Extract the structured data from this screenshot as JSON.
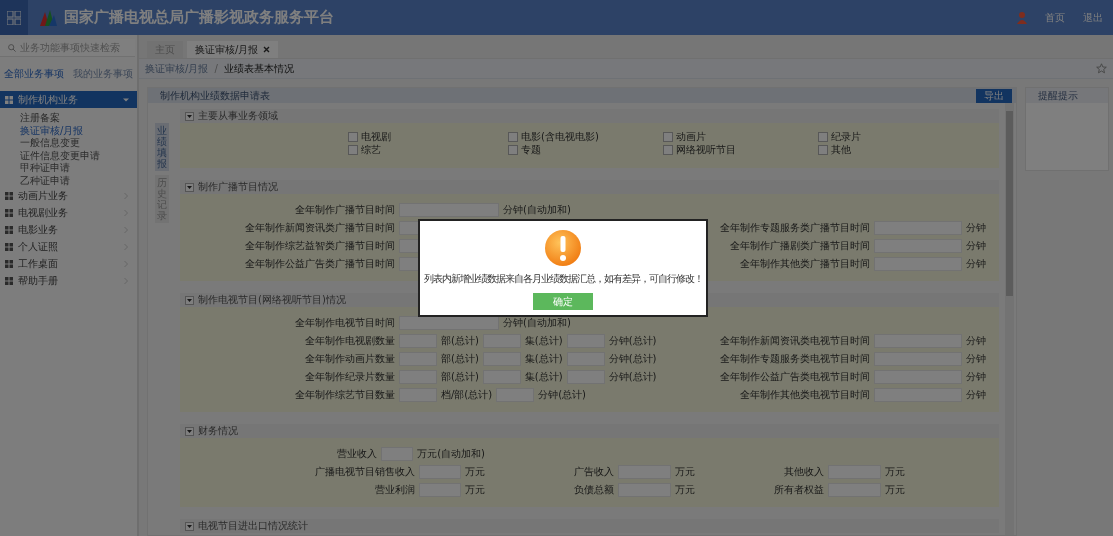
{
  "header": {
    "title": "国家广播电视总局广播影视政务服务平台",
    "links": [
      "首页",
      "退出"
    ]
  },
  "sidebar": {
    "search_placeholder": "业务功能事项快速检索",
    "tabs": [
      {
        "label": "全部业务事项",
        "selected": true
      },
      {
        "label": "我的业务事项",
        "selected": false
      }
    ],
    "menu": [
      {
        "label": "制作机构业务",
        "expanded": true,
        "selected": true,
        "children": [
          {
            "label": "注册备案",
            "selected": false
          },
          {
            "label": "换证审核/月报",
            "selected": true
          },
          {
            "label": "一般信息变更",
            "selected": false
          },
          {
            "label": "证件信息变更申请",
            "selected": false
          },
          {
            "label": "甲种证申请",
            "selected": false
          },
          {
            "label": "乙种证申请",
            "selected": false
          }
        ]
      },
      {
        "label": "动画片业务",
        "expanded": false,
        "selected": false
      },
      {
        "label": "电视剧业务",
        "expanded": false,
        "selected": false
      },
      {
        "label": "电影业务",
        "expanded": false,
        "selected": false
      },
      {
        "label": "个人证照",
        "expanded": false,
        "selected": false
      },
      {
        "label": "工作桌面",
        "expanded": false,
        "selected": false
      },
      {
        "label": "帮助手册",
        "expanded": false,
        "selected": false
      }
    ]
  },
  "tabs": [
    {
      "label": "主页",
      "selected": false,
      "closable": false
    },
    {
      "label": "换证审核/月报",
      "selected": true,
      "closable": true
    }
  ],
  "breadcrumb": {
    "separator": "/",
    "items": [
      "换证审核/月报",
      "业绩表基本情况"
    ]
  },
  "panel": {
    "title": "制作机构业绩数据申请表",
    "export_button": "导出",
    "side_tabs": [
      {
        "label": "业绩填报",
        "selected": true
      },
      {
        "label": "历史记录",
        "selected": false
      }
    ],
    "sections": [
      {
        "title": "主要从事业务领域",
        "kind": "checkboxes",
        "items": [
          {
            "label": "电视剧",
            "checked": false
          },
          {
            "label": "电影(含电视电影)",
            "checked": false
          },
          {
            "label": "动画片",
            "checked": false
          },
          {
            "label": "纪录片",
            "checked": false
          },
          {
            "label": "综艺",
            "checked": false
          },
          {
            "label": "专题",
            "checked": false
          },
          {
            "label": "网络视听节目",
            "checked": false
          },
          {
            "label": "其他",
            "checked": false
          }
        ]
      },
      {
        "title": "制作广播节目情况",
        "kind": "form",
        "rows": [
          {
            "fields": [
              {
                "label": "全年制作广播节目时间",
                "units": [
                  "分钟(自动加和)"
                ]
              }
            ]
          },
          {
            "fields": [
              {
                "label": "全年制作新闻资讯类广播节目时间"
              },
              {
                "label": "全年制作专题服务类广播节目时间",
                "units": [
                  "分钟"
                ]
              }
            ]
          },
          {
            "fields": [
              {
                "label": "全年制作综艺益智类广播节目时间"
              },
              {
                "label": "全年制作广播剧类广播节目时间",
                "units": [
                  "分钟"
                ]
              }
            ]
          },
          {
            "fields": [
              {
                "label": "全年制作公益广告类广播节目时间"
              },
              {
                "label": "全年制作其他类广播节目时间",
                "units": [
                  "分钟"
                ]
              }
            ]
          }
        ]
      },
      {
        "title": "制作电视节目(网络视听节目)情况",
        "kind": "form",
        "rows": [
          {
            "fields": [
              {
                "label": "全年制作电视节目时间",
                "units": [
                  "分钟(自动加和)"
                ]
              }
            ]
          },
          {
            "fields": [
              {
                "label": "全年制作电视剧数量",
                "units": [
                  "部(总计)",
                  "集(总计)",
                  "分钟(总计)"
                ]
              },
              {
                "label": "全年制作新闻资讯类电视节目时间",
                "units": [
                  "分钟"
                ]
              }
            ]
          },
          {
            "fields": [
              {
                "label": "全年制作动画片数量",
                "units": [
                  "部(总计)",
                  "集(总计)",
                  "分钟(总计)"
                ]
              },
              {
                "label": "全年制作专题服务类电视节目时间",
                "units": [
                  "分钟"
                ]
              }
            ]
          },
          {
            "fields": [
              {
                "label": "全年制作纪录片数量",
                "units": [
                  "部(总计)",
                  "集(总计)",
                  "分钟(总计)"
                ]
              },
              {
                "label": "全年制作公益广告类电视节目时间",
                "units": [
                  "分钟"
                ]
              }
            ]
          },
          {
            "fields": [
              {
                "label": "全年制作综艺节目数量",
                "units": [
                  "档/部(总计)",
                  "分钟(总计)"
                ]
              },
              {
                "label": "全年制作其他类电视节目时间",
                "units": [
                  "分钟"
                ]
              }
            ]
          }
        ]
      },
      {
        "title": "财务情况",
        "kind": "finance",
        "rows": [
          {
            "fields": [
              {
                "label": "营业收入",
                "units": [
                  "万元(自动加和)"
                ]
              }
            ]
          },
          {
            "fields": [
              {
                "label": "广播电视节目销售收入",
                "units": [
                  "万元"
                ]
              },
              {
                "label": "广告收入",
                "units": [
                  "万元"
                ]
              },
              {
                "label": "其他收入",
                "units": [
                  "万元"
                ]
              }
            ]
          },
          {
            "fields": [
              {
                "label": "营业利润",
                "units": [
                  "万元"
                ]
              },
              {
                "label": "负债总额",
                "units": [
                  "万元"
                ]
              },
              {
                "label": "所有者权益",
                "units": [
                  "万元"
                ]
              }
            ]
          }
        ]
      },
      {
        "title": "电视节目进出口情况统计",
        "kind": "collapsed"
      }
    ]
  },
  "notice": {
    "title": "提醒提示"
  },
  "dialog": {
    "message": "列表内新增业绩数据来自各月业绩数据汇总，如有差异，可自行修改！",
    "button": "确定"
  }
}
